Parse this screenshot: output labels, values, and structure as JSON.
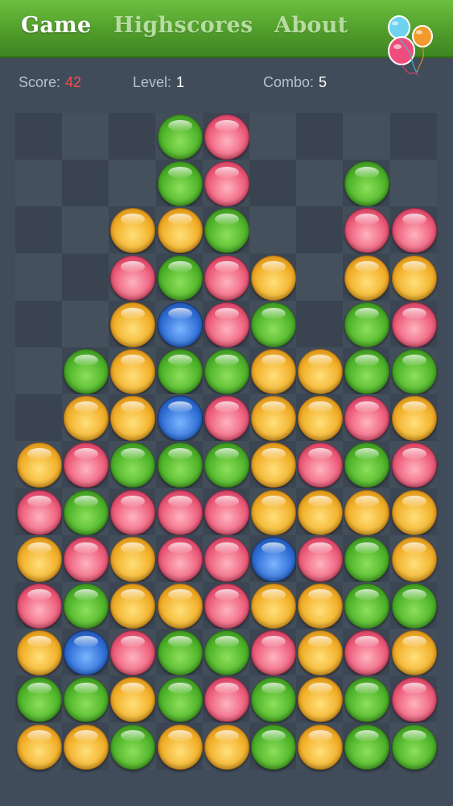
{
  "nav": {
    "tabs": [
      {
        "label": "Game",
        "active": true
      },
      {
        "label": "Highscores",
        "active": false
      },
      {
        "label": "About",
        "active": false
      }
    ],
    "logo_icon": "balloons-icon"
  },
  "stats": {
    "score_label": "Score:",
    "score_value": "42",
    "level_label": "Level:",
    "level_value": "1",
    "combo_label": "Combo:",
    "combo_value": "5"
  },
  "colors": {
    "G": "green",
    "P": "pink",
    "O": "orange",
    "B": "blue",
    "accent_red": "#f05050",
    "header_green": "#4f9a2a"
  },
  "board": {
    "columns": 9,
    "rows": [
      ".  .  .  G  P  .  .  .  .",
      ".  .  .  G  P  .  .  G  .",
      ".  .  O  O  G  .  .  P  P",
      ".  .  P  G  P  O  .  O  O",
      ".  .  O  B  P  G  .  G  P",
      ".  G  O  G  G  O  O  G  G",
      ".  O  O  B  P  O  O  P  O",
      "O  P  G  G  G  O  P  G  P",
      "P  G  P  P  P  O  O  O  O",
      "O  P  O  P  P  B  P  G  O",
      "P  G  O  O  P  O  O  G  G",
      "O  B  P  G  G  P  O  P  O",
      "G  G  O  G  P  G  O  G  P",
      "O  O  G  O  O  G  O  G  G"
    ]
  }
}
